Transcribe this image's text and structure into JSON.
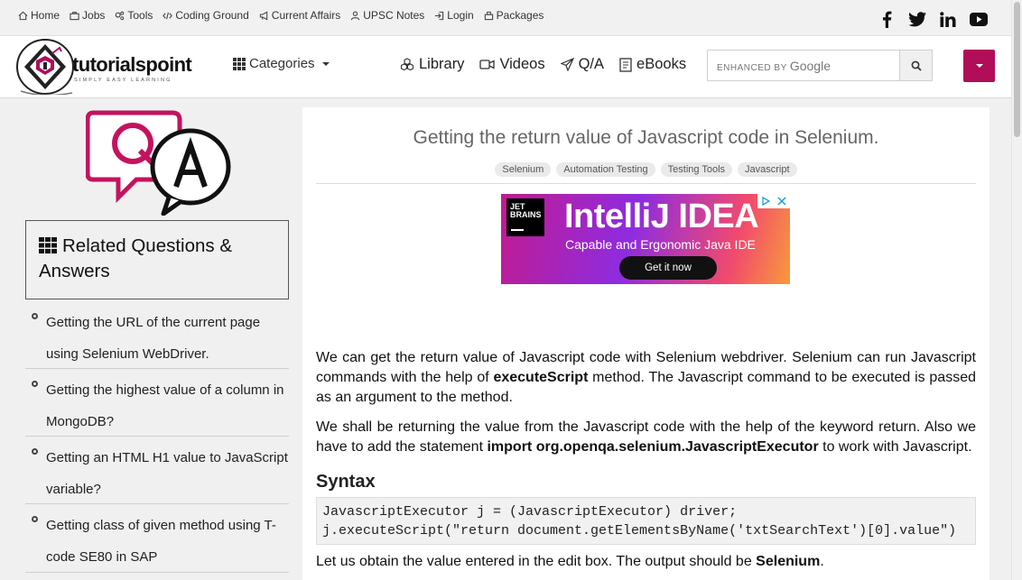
{
  "topbar": {
    "links": [
      {
        "label": "Home",
        "icon": "home-icon"
      },
      {
        "label": "Jobs",
        "icon": "briefcase-icon"
      },
      {
        "label": "Tools",
        "icon": "cogs-icon"
      },
      {
        "label": "Coding Ground",
        "icon": "code-icon"
      },
      {
        "label": "Current Affairs",
        "icon": "megaphone-icon"
      },
      {
        "label": "UPSC Notes",
        "icon": "user-tie-icon"
      },
      {
        "label": "Login",
        "icon": "login-icon"
      },
      {
        "label": "Packages",
        "icon": "package-icon"
      }
    ],
    "social": [
      "facebook-icon",
      "twitter-icon",
      "linkedin-icon",
      "youtube-icon"
    ]
  },
  "header": {
    "logo_main": "tutorialspoint",
    "logo_tagline": "SIMPLY EASY LEARNING",
    "categories_label": "Categories",
    "nav": [
      {
        "label": "Library",
        "icon": "cubes-icon"
      },
      {
        "label": "Videos",
        "icon": "video-icon"
      },
      {
        "label": "Q/A",
        "icon": "send-icon"
      },
      {
        "label": "eBooks",
        "icon": "book-icon"
      }
    ],
    "search_prefix": "ENHANCED BY",
    "search_brand": "Google",
    "search_value": ""
  },
  "sidebar": {
    "related_title": "Related Questions & Answers",
    "questions": [
      "Getting the URL of the current page using Selenium WebDriver.",
      "Getting the highest value of a column in MongoDB?",
      "Getting an HTML H1 value to JavaScript variable?",
      "Getting class of given method using T-code SE80 in SAP"
    ]
  },
  "article": {
    "title": "Getting the return value of Javascript code in Selenium.",
    "tags": [
      "Selenium",
      "Automation Testing",
      "Testing Tools",
      "Javascript"
    ],
    "ad": {
      "brand_line1": "JET",
      "brand_line2": "BRAINS",
      "headline": "IntelliJ IDEA",
      "subline": "Capable and Ergonomic Java IDE",
      "cta": "Get it now"
    },
    "p1_a": "We can get the return value of Javascript code with Selenium webdriver. Selenium can run Javascript commands with the help of ",
    "p1_b": "executeScript",
    "p1_c": " method. The Javascript command to be executed is passed as an argument to the method.",
    "p2_a": "We shall be returning the value from the Javascript code with the help of the keyword return. Also we have to add the statement ",
    "p2_b": "import org.openqa.selenium.JavascriptExecutor",
    "p2_c": " to work with Javascript.",
    "syntax_heading": "Syntax",
    "code": "JavascriptExecutor j = (JavascriptExecutor) driver;\nj.executeScript(\"return document.getElementsByName('txtSearchText')[0].value\")",
    "p3_a": "Let us obtain the value entered in the edit box. The output should be ",
    "p3_b": "Selenium",
    "p3_c": "."
  },
  "colors": {
    "brand": "#b10d58",
    "logo_green": "#5c9a3a"
  }
}
